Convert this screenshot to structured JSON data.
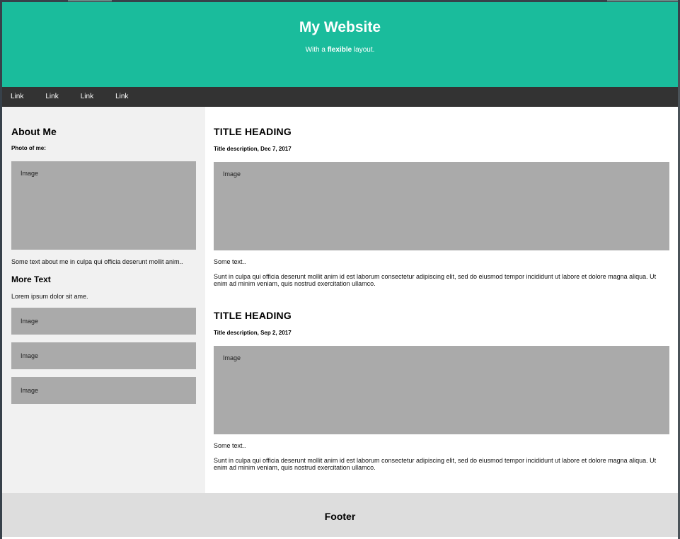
{
  "header": {
    "title": "My Website",
    "subtitle_pre": "With a ",
    "subtitle_bold": "flexible",
    "subtitle_post": " layout."
  },
  "nav": {
    "links": [
      "Link",
      "Link",
      "Link",
      "Link"
    ]
  },
  "sidebar": {
    "about_title": "About Me",
    "photo_label": "Photo of me:",
    "photo_placeholder": "Image",
    "about_text": "Some text about me in culpa qui officia deserunt mollit anim..",
    "more_title": "More Text",
    "more_text": "Lorem ipsum dolor sit ame.",
    "images": [
      "Image",
      "Image",
      "Image"
    ]
  },
  "main": {
    "posts": [
      {
        "title": "TITLE HEADING",
        "description": "Title description, Dec 7, 2017",
        "image": "Image",
        "short_text": "Some text..",
        "body": "Sunt in culpa qui officia deserunt mollit anim id est laborum consectetur adipiscing elit, sed do eiusmod tempor incididunt ut labore et dolore magna aliqua. Ut enim ad minim veniam, quis nostrud exercitation ullamco."
      },
      {
        "title": "TITLE HEADING",
        "description": "Title description, Sep 2, 2017",
        "image": "Image",
        "short_text": "Some text..",
        "body": "Sunt in culpa qui officia deserunt mollit anim id est laborum consectetur adipiscing elit, sed do eiusmod tempor incididunt ut labore et dolore magna aliqua. Ut enim ad minim veniam, quis nostrud exercitation ullamco."
      }
    ]
  },
  "footer": {
    "text": "Footer"
  },
  "colors": {
    "header_bg": "#1abc9c",
    "navbar_bg": "#333333",
    "sidebar_bg": "#f1f1f1",
    "placeholder_bg": "#aaaaaa",
    "footer_bg": "#dddddd"
  }
}
